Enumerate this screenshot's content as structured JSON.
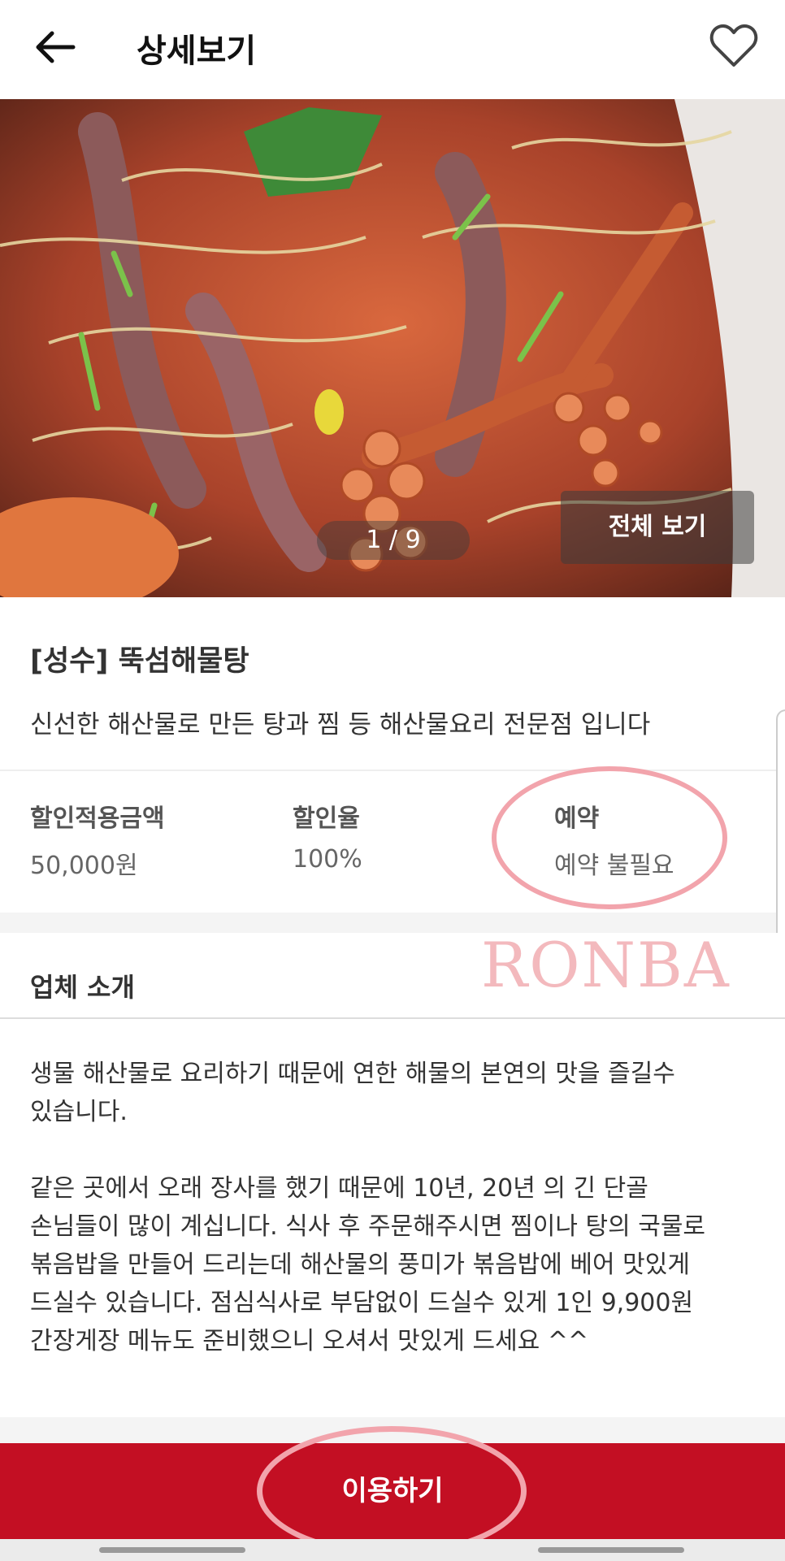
{
  "header": {
    "title": "상세보기",
    "back_icon": "arrow-left-icon",
    "favorite_icon": "heart-outline-icon"
  },
  "gallery": {
    "pager": "1 / 9",
    "view_all_label": "전체 보기"
  },
  "shop": {
    "name": "[성수] 뚝섬해물탕",
    "description": "신선한 해산물로 만든 탕과 찜 등 해산물요리 전문점 입니다"
  },
  "stats": [
    {
      "label": "할인적용금액",
      "value": "50,000원"
    },
    {
      "label": "할인율",
      "value": "100%"
    },
    {
      "label": "예약",
      "value": "예약 불필요"
    }
  ],
  "intro": {
    "title": "업체 소개",
    "body": "생물 해산물로 요리하기 때문에 연한 해물의 본연의 맛을 즐길수\n있습니다.\n\n같은 곳에서 오래 장사를 했기 때문에 10년, 20년 의 긴 단골\n손님들이 많이 계십니다. 식사 후 주문해주시면 찜이나 탕의 국물로\n볶음밥을 만들어 드리는데 해산물의 풍미가 볶음밥에 베어 맛있게\n드실수 있습니다. 점심식사로 부담없이 드실수 있게  1인 9,900원\n간장게장 메뉴도 준비했으니 오셔서 맛있게 드세요 ^^"
  },
  "watermark": "RONBA",
  "cta": {
    "label": "이용하기"
  },
  "colors": {
    "accent": "#c30f23",
    "annotation": "#f2a4ac"
  }
}
